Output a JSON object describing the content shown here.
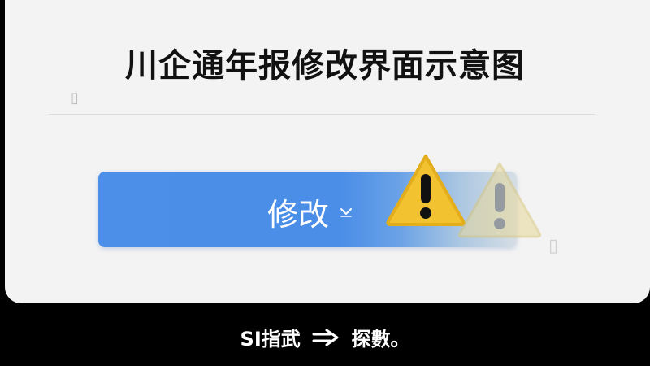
{
  "page": {
    "title": "川企通年报修改界面示意图"
  },
  "button": {
    "label": "修改",
    "chevron_icon": "chevron-down-icon"
  },
  "warnings": [
    {
      "icon": "warning-icon",
      "color": "#f2c230"
    },
    {
      "icon": "warning-icon",
      "color": "#e8d89a"
    }
  ],
  "caption": {
    "left_text": "SI指武",
    "arrow_icon": "arrow-right-icon",
    "right_text": "探數。"
  },
  "colors": {
    "button_blue": "#4a8ee8",
    "warning_yellow": "#f2c230",
    "panel_bg": "#f3f3f3"
  }
}
